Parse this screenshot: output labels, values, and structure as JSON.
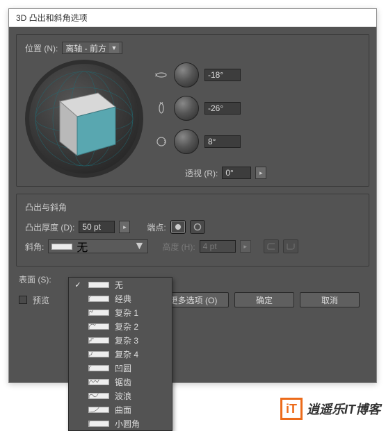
{
  "dialog": {
    "title": "3D 凸出和斜角选项"
  },
  "position": {
    "label": "位置 (N):",
    "value": "离轴 - 前方"
  },
  "rotation": {
    "x": {
      "value": "-18°"
    },
    "y": {
      "value": "-26°"
    },
    "z": {
      "value": "8°"
    }
  },
  "perspective": {
    "label": "透视 (R):",
    "value": "0°"
  },
  "extrude_panel": {
    "title": "凸出与斜角",
    "depth_label": "凸出厚度 (D):",
    "depth_value": "50 pt",
    "cap_label": "端点:",
    "bevel_label": "斜角:",
    "bevel_value": "无",
    "height_label": "高度 (H):",
    "height_value": "4 pt"
  },
  "surface": {
    "label": "表面 (S):"
  },
  "preview": {
    "label": "预览"
  },
  "buttons": {
    "more": "更多选项 (O)",
    "ok": "确定",
    "cancel": "取消"
  },
  "bevel_options": [
    {
      "label": "无",
      "checked": true,
      "shape": "none"
    },
    {
      "label": "经典",
      "shape": "classic"
    },
    {
      "label": "复杂 1",
      "shape": "complex1"
    },
    {
      "label": "复杂 2",
      "shape": "complex2"
    },
    {
      "label": "复杂 3",
      "shape": "complex3"
    },
    {
      "label": "复杂 4",
      "shape": "complex4"
    },
    {
      "label": "凹圆",
      "shape": "cove"
    },
    {
      "label": "锯齿",
      "shape": "zigzag"
    },
    {
      "label": "波浪",
      "shape": "wave"
    },
    {
      "label": "曲面",
      "shape": "curve"
    },
    {
      "label": "小圆角",
      "shape": "fillet"
    }
  ],
  "watermark": {
    "logo": "iT",
    "text": "逍遥乐IT博客"
  }
}
